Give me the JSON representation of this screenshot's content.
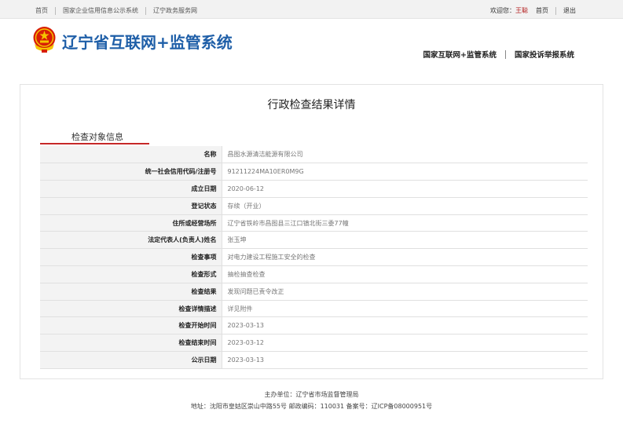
{
  "topbar": {
    "links": [
      "首页",
      "国家企业信用信息公示系统",
      "辽宁政务服务网"
    ],
    "welcome": "欢迎您：",
    "user": "王聪",
    "home": "首页",
    "logout": "退出"
  },
  "header": {
    "title": "辽宁省互联网+监管系统",
    "links": [
      "国家互联网+监管系统",
      "国家投诉举报系统"
    ],
    "emblem_color": "#d81e06"
  },
  "main": {
    "heading": "行政检查结果详情",
    "tab": "检查对象信息",
    "rows": [
      {
        "key": "名称",
        "value": "昌图水源清洁能源有限公司"
      },
      {
        "key": "统一社会信用代码/注册号",
        "value": "91211224MA10ER0M9G"
      },
      {
        "key": "成立日期",
        "value": "2020-06-12"
      },
      {
        "key": "登记状态",
        "value": "存续（开业）"
      },
      {
        "key": "住所或经营场所",
        "value": "辽宁省铁岭市昌图县三江口镇北街三委77幢"
      },
      {
        "key": "法定代表人(负责人)姓名",
        "value": "张玉坤"
      },
      {
        "key": "检查事项",
        "value": "对电力建设工程施工安全的检查"
      },
      {
        "key": "检查形式",
        "value": "抽检抽查检查"
      },
      {
        "key": "检查结果",
        "value": "发现问题已责令改正"
      },
      {
        "key": "检查详情描述",
        "value": "详见附件"
      },
      {
        "key": "检查开始时间",
        "value": "2023-03-13"
      },
      {
        "key": "检查结束时间",
        "value": "2023-03-12"
      },
      {
        "key": "公示日期",
        "value": "2023-03-13"
      }
    ]
  },
  "footer": {
    "sponsor": "主办单位：辽宁省市场监督管理局",
    "address": "地址：沈阳市皇姑区崇山中路55号 邮政编码：110031 备案号：辽ICP备08000951号"
  }
}
